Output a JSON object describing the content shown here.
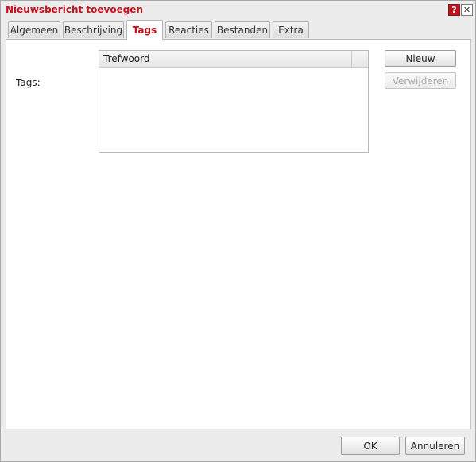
{
  "window": {
    "title": "Nieuwsbericht toevoegen",
    "help_label": "?",
    "close_label": "✕",
    "accent_color": "#c1121f"
  },
  "tabs": [
    {
      "label": "Algemeen",
      "active": false
    },
    {
      "label": "Beschrijving",
      "active": false
    },
    {
      "label": "Tags",
      "active": true
    },
    {
      "label": "Reacties",
      "active": false
    },
    {
      "label": "Bestanden",
      "active": false
    },
    {
      "label": "Extra",
      "active": false
    }
  ],
  "tags_panel": {
    "label": "Tags:",
    "grid": {
      "columns": [
        "Trefwoord"
      ],
      "rows": []
    },
    "new_button": "Nieuw",
    "remove_button": "Verwijderen",
    "remove_disabled": true
  },
  "footer": {
    "ok_label": "OK",
    "cancel_label": "Annuleren"
  }
}
